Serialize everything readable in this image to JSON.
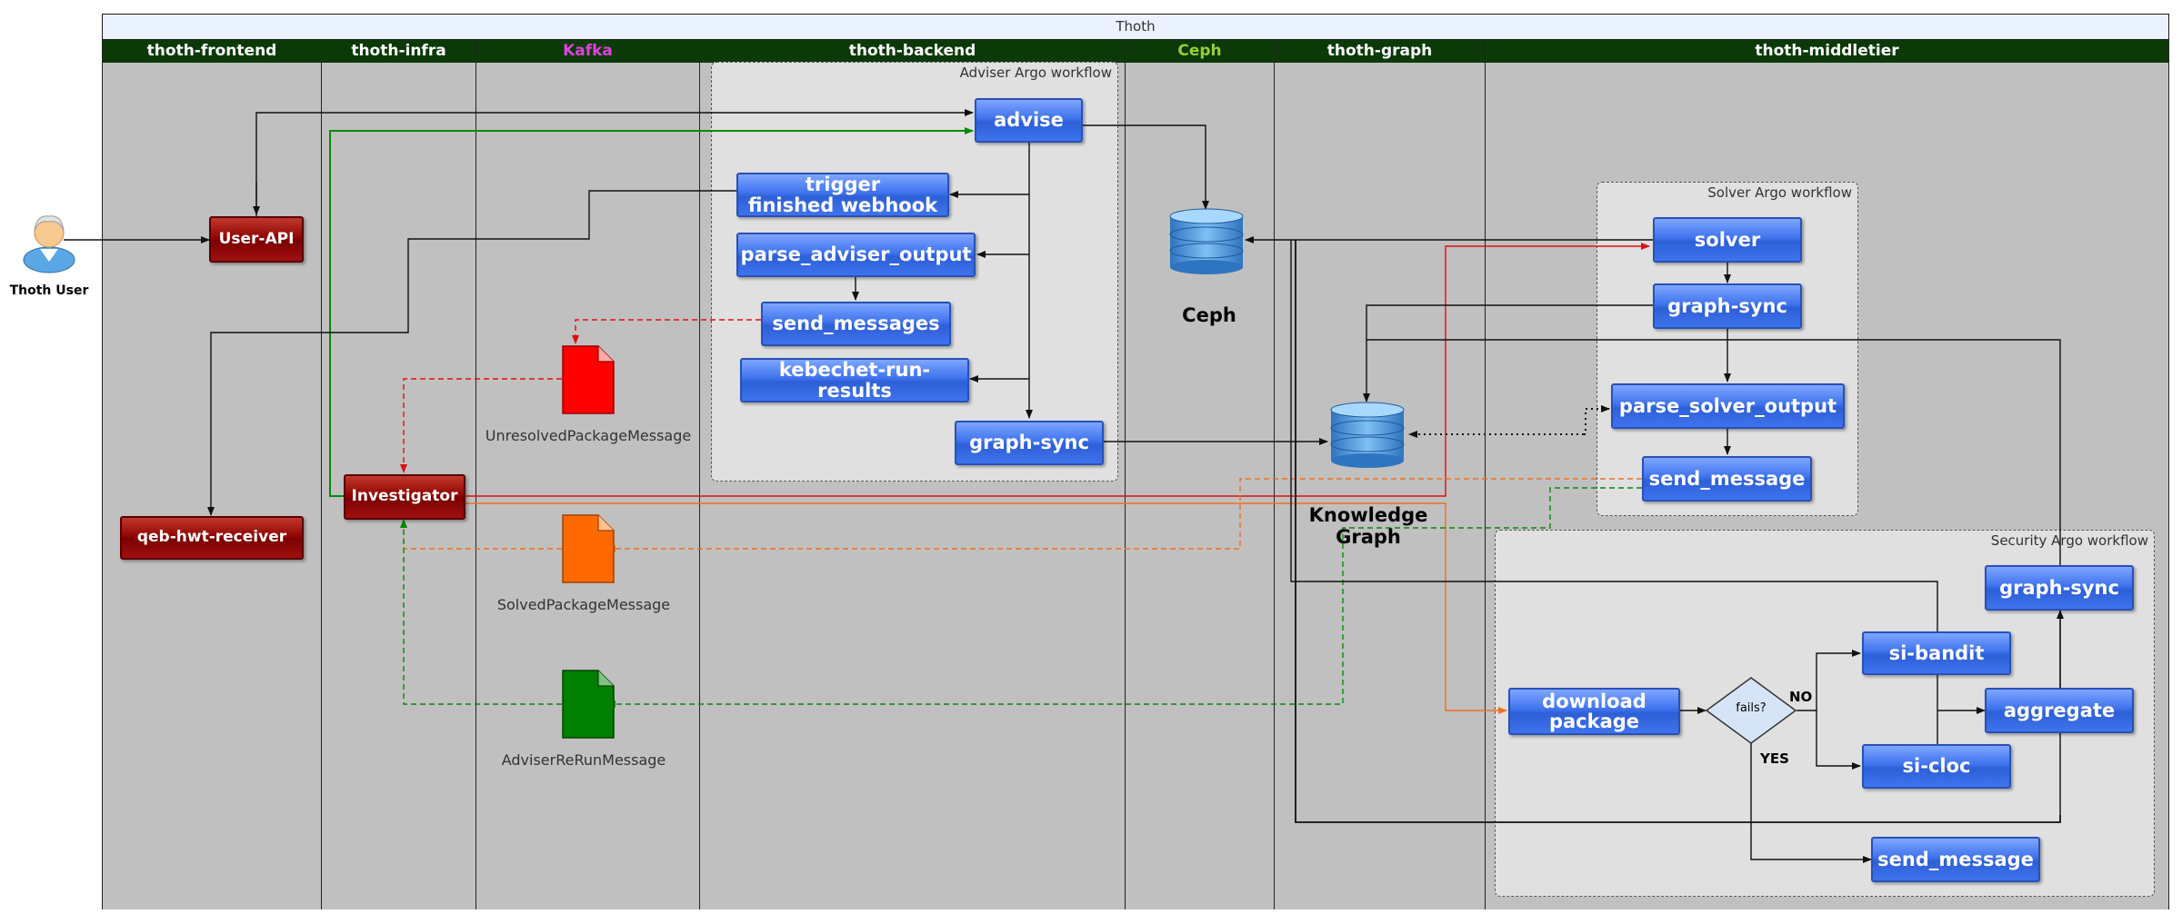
{
  "diagram_title": "Thoth",
  "lanes": {
    "frontend": "thoth-frontend",
    "infra": "thoth-infra",
    "kafka": "Kafka",
    "backend": "thoth-backend",
    "ceph": "Ceph",
    "graph": "thoth-graph",
    "middletier": "thoth-middletier"
  },
  "frames": {
    "adviser": "Adviser Argo workflow",
    "solver": "Solver Argo workflow",
    "security": "Security Argo workflow"
  },
  "actor": {
    "label": "Thoth User",
    "icon": "user-icon"
  },
  "frontend": {
    "user_api": "User-API",
    "qeb": "qeb-hwt-receiver"
  },
  "infra": {
    "investigator": "Investigator"
  },
  "kafka": {
    "unresolved": "UnresolvedPackageMessage",
    "solved": "SolvedPackageMessage",
    "rerun": "AdviserReRunMessage"
  },
  "backend": {
    "advise": "advise",
    "trigger": "trigger\nfinished webhook",
    "parse": "parse_adviser_output",
    "send": "send_messages",
    "kebechet": "kebechet-run-results",
    "graph_sync": "graph-sync"
  },
  "ceph": {
    "label": "Ceph"
  },
  "graph": {
    "label": "Knowledge Graph"
  },
  "solver": {
    "solver": "solver",
    "graph_sync": "graph-sync",
    "parse": "parse_solver_output",
    "send": "send_message"
  },
  "security": {
    "download": "download\npackage",
    "decision": "fails?",
    "no": "NO",
    "yes": "YES",
    "bandit": "si-bandit",
    "cloc": "si-cloc",
    "aggregate": "aggregate",
    "graph_sync": "graph-sync",
    "send": "send_message"
  },
  "colors": {
    "lane_header": "#0b3a08",
    "kafka_label": "#e040e0",
    "ceph_label": "#9acd32",
    "unresolved_doc": "#ff0000",
    "solved_doc": "#ff6a00",
    "rerun_doc": "#008000",
    "task_blue": "#3f73ee",
    "service_red": "#8c0000"
  }
}
